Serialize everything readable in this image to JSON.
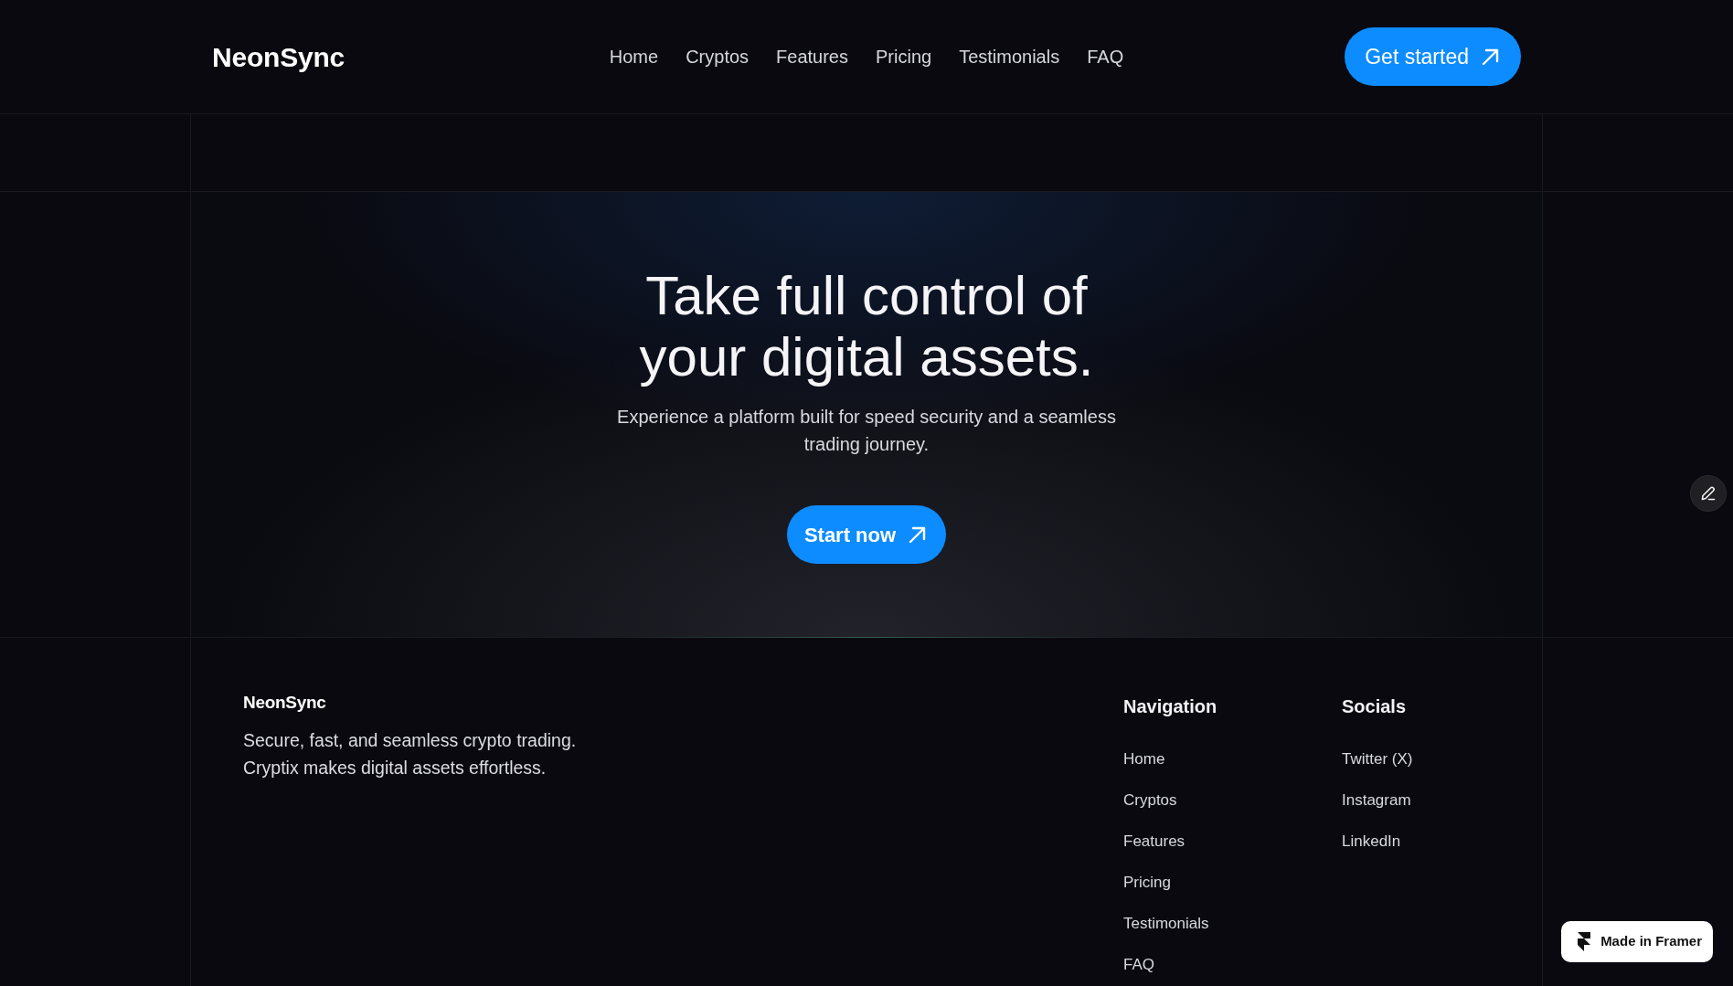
{
  "header": {
    "logo": "NeonSync",
    "nav_links": [
      "Home",
      "Cryptos",
      "Features",
      "Pricing",
      "Testimonials",
      "FAQ"
    ],
    "cta_button": "Get started"
  },
  "hero": {
    "title": "Take full control of your digital assets.",
    "subtitle": "Experience a platform built for speed security and a seamless trading journey.",
    "cta_button": "Start now"
  },
  "footer": {
    "logo": "NeonSync",
    "tagline": "Secure, fast, and seamless crypto trading. Cryptix makes digital assets effortless.",
    "columns": [
      {
        "heading": "Navigation",
        "links": [
          "Home",
          "Cryptos",
          "Features",
          "Pricing",
          "Testimonials",
          "FAQ"
        ]
      },
      {
        "heading": "Socials",
        "links": [
          "Twitter (X)",
          "Instagram",
          "LinkedIn"
        ]
      }
    ]
  },
  "badge": {
    "label": "Made in Framer"
  }
}
